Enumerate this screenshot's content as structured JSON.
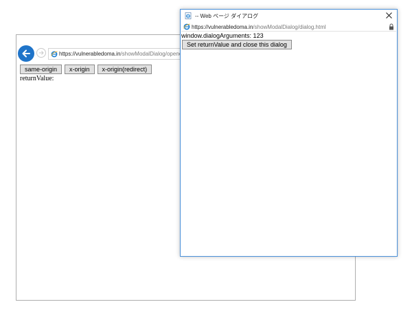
{
  "opener": {
    "address": {
      "url_host": "https://vulnerabledoma.in",
      "url_path": "/showModalDialog/opener.html"
    },
    "buttons": [
      {
        "label": "same-origin"
      },
      {
        "label": "x-origin"
      },
      {
        "label": "x-origin(redirect)"
      }
    ],
    "return_value_label": "returnValue:"
  },
  "dialog": {
    "title": "-- Web ページ ダイアログ",
    "address": {
      "url_host": "https://vulnerabledoma.in",
      "url_path": "/showModalDialog/dialog.html"
    },
    "arguments_text": "window.dialogArguments: 123",
    "set_button_label": "Set returnValue and close this dialog"
  },
  "colors": {
    "back_button": "#1f74c9",
    "dialog_border": "#4a90d9",
    "ie_icon": "#1c7fd1"
  },
  "icons": {
    "back": "arrow-left-icon",
    "forward": "arrow-right-icon",
    "browser": "ie-icon",
    "close": "close-icon",
    "lock": "lock-icon"
  }
}
